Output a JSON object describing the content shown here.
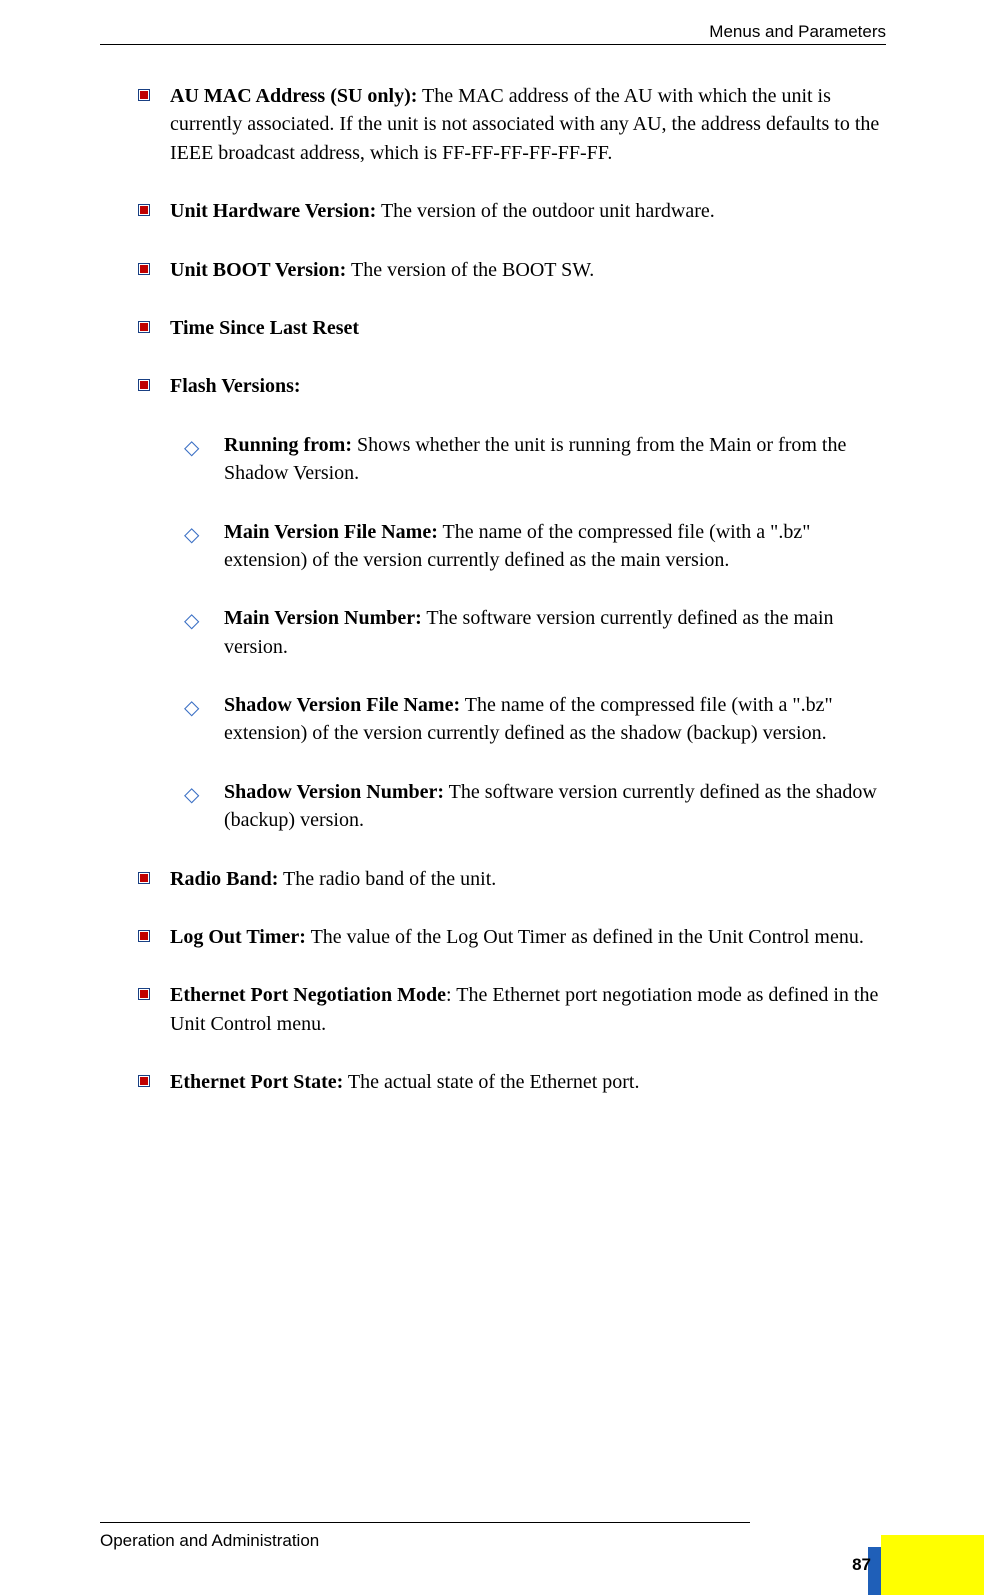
{
  "header": {
    "title": "Menus and Parameters"
  },
  "items": [
    {
      "label": "AU MAC Address (SU only):",
      "text": " The MAC address of the AU with which the unit is currently associated. If the unit is not associated with any AU, the address defaults to the IEEE broadcast address, which is FF-FF-FF-FF-FF-FF."
    },
    {
      "label": "Unit Hardware Version:",
      "text": " The version of the outdoor unit hardware."
    },
    {
      "label": "Unit BOOT Version:",
      "text": " The version of the BOOT SW."
    },
    {
      "label": "Time Since Last Reset",
      "text": ""
    },
    {
      "label": "Flash Versions:",
      "text": "",
      "subs": [
        {
          "label": "Running from:",
          "text": " Shows whether the unit is running from the Main or from the Shadow Version."
        },
        {
          "label": "Main Version File Name:",
          "text": " The name of the compressed file (with a \".bz\" extension) of the version currently defined as the main version."
        },
        {
          "label": "Main Version Number:",
          "text": " The software version currently defined as the main version."
        },
        {
          "label": "Shadow Version File Name:",
          "text": " The name of the compressed file (with a \".bz\" extension) of the version currently defined as the shadow (backup) version."
        },
        {
          "label": "Shadow Version Number:",
          "text": " The software version currently defined as the shadow (backup) version."
        }
      ]
    },
    {
      "label": "Radio Band:",
      "text": " The radio band of the unit."
    },
    {
      "label": "Log Out Timer:",
      "text": " The value of the Log Out Timer as defined in the Unit Control menu."
    },
    {
      "label": "Ethernet Port Negotiation Mode",
      "text": ": The Ethernet port negotiation mode as defined in the Unit Control menu."
    },
    {
      "label": "Ethernet Port State:",
      "text": " The actual state of the Ethernet port."
    }
  ],
  "footer": {
    "text": "Operation and Administration",
    "page": "87"
  }
}
